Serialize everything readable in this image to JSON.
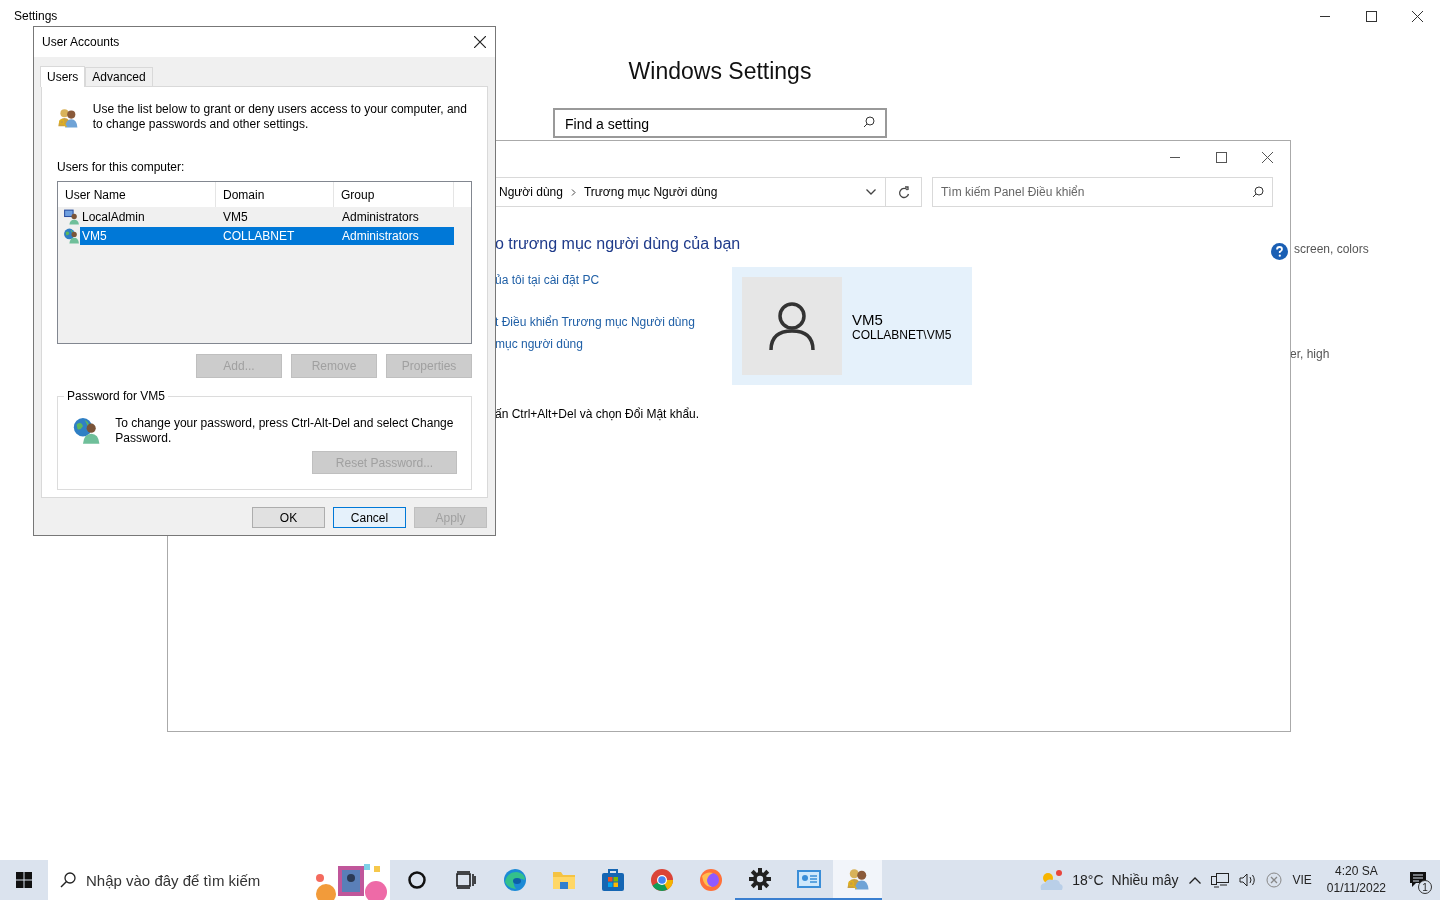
{
  "settings_window": {
    "title": "Settings",
    "heading": "Windows Settings",
    "search": {
      "placeholder": "Find a setting"
    },
    "descriptions": [
      "screen, colors",
      "er, high"
    ]
  },
  "control_panel": {
    "breadcrumb": [
      "Người dùng",
      "Trương mục Người dùng"
    ],
    "search": {
      "placeholder": "Tìm kiếm Panel Điều khiển"
    },
    "heading": "o trương mục người dùng của bạn",
    "links": [
      "ủa tôi tại cài đặt PC",
      "t Điều khiển Trương mục Người dùng",
      "mục người dùng"
    ],
    "account": {
      "name": "VM5",
      "full_name": "COLLABNET\\VM5"
    },
    "note": "ấn Ctrl+Alt+Del và chọn Đổi Mật khẩu."
  },
  "dialog": {
    "title": "User Accounts",
    "tabs": [
      {
        "label": "Users",
        "selected": true
      },
      {
        "label": "Advanced",
        "selected": false
      }
    ],
    "intro": "Use the list below to grant or deny users access to your computer, and to change passwords and other settings.",
    "list_label": "Users for this computer:",
    "columns": [
      "User Name",
      "Domain",
      "Group"
    ],
    "rows": [
      {
        "kind": "local",
        "cells": [
          "LocalAdmin",
          "VM5",
          "Administrators"
        ],
        "selected": false
      },
      {
        "kind": "domain",
        "cells": [
          "VM5",
          "COLLABNET",
          "Administrators"
        ],
        "selected": true
      }
    ],
    "list_buttons": [
      {
        "label": "Add...",
        "disabled": true
      },
      {
        "label": "Remove",
        "disabled": true
      },
      {
        "label": "Properties",
        "disabled": true
      }
    ],
    "password_group": {
      "title": "Password for VM5",
      "text": "To change your password, press Ctrl-Alt-Del and select Change Password.",
      "button": {
        "label": "Reset Password...",
        "disabled": true
      }
    },
    "buttons": [
      {
        "label": "OK",
        "disabled": false,
        "focused": false
      },
      {
        "label": "Cancel",
        "disabled": false,
        "focused": true
      },
      {
        "label": "Apply",
        "disabled": true,
        "focused": false
      }
    ]
  },
  "taskbar": {
    "search": {
      "placeholder": "Nhập vào đây để tìm kiếm"
    },
    "apps": [
      {
        "kind": "cortana",
        "running": false,
        "active": false
      },
      {
        "kind": "task-view",
        "running": false,
        "active": false
      },
      {
        "kind": "edge",
        "running": false,
        "active": false
      },
      {
        "kind": "explorer",
        "running": false,
        "active": false
      },
      {
        "kind": "store",
        "running": false,
        "active": false
      },
      {
        "kind": "chrome",
        "running": false,
        "active": false
      },
      {
        "kind": "firefox",
        "running": false,
        "active": false
      },
      {
        "kind": "settings",
        "running": true,
        "active": false
      },
      {
        "kind": "control-panel",
        "running": true,
        "active": false
      },
      {
        "kind": "user-accounts",
        "running": true,
        "active": true
      }
    ],
    "weather": {
      "temperature": "18°C",
      "condition": "Nhiều mây"
    },
    "language": "VIE",
    "time": "4:20 SA",
    "date": "01/11/2022",
    "notifications": "1"
  }
}
